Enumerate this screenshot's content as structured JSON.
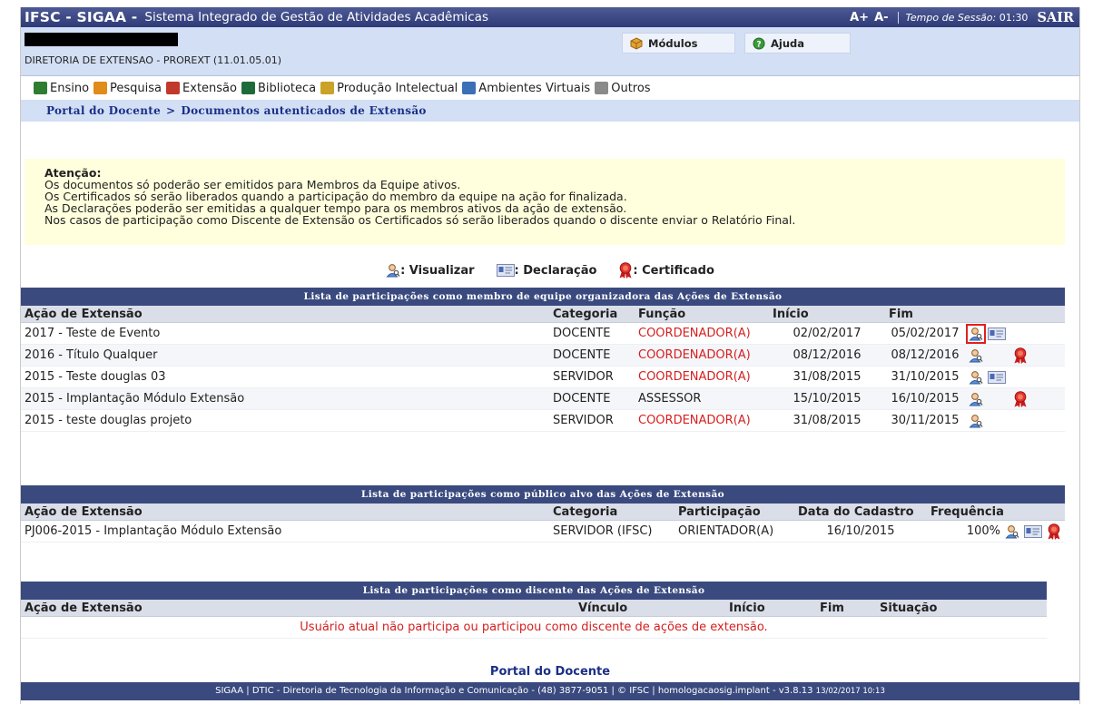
{
  "header": {
    "brand": "IFSC - SIGAA -",
    "system": "Sistema Integrado de Gestão de Atividades Acadêmicas",
    "font_up": "A+",
    "font_down": "A-",
    "session_label": "Tempo de Sessão:",
    "session_time": "01:30",
    "logout": "SAIR"
  },
  "info": {
    "department": "DIRETORIA DE EXTENSAO - PROREXT (11.01.05.01)",
    "modules_label": "Módulos",
    "help_label": "Ajuda"
  },
  "menu": [
    {
      "label": "Ensino",
      "icon": "books-icon",
      "color": "#2e7d32"
    },
    {
      "label": "Pesquisa",
      "icon": "flask-icon",
      "color": "#e08b1a"
    },
    {
      "label": "Extensão",
      "icon": "handshake-icon",
      "color": "#c0392b"
    },
    {
      "label": "Biblioteca",
      "icon": "library-icon",
      "color": "#1e6b3a"
    },
    {
      "label": "Produção Intelectual",
      "icon": "document-icon",
      "color": "#c9a227"
    },
    {
      "label": "Ambientes Virtuais",
      "icon": "people-icon",
      "color": "#3b6fb6"
    },
    {
      "label": "Outros",
      "icon": "gear-icon",
      "color": "#8a8a8a"
    }
  ],
  "breadcrumb": {
    "root": "Portal do Docente",
    "separator": ">",
    "current": "Documentos autenticados de Extensão"
  },
  "attention": {
    "title": "Atenção:",
    "lines": [
      "Os documentos só poderão ser emitidos para Membros da Equipe ativos.",
      "Os Certificados só serão liberados quando a participação do membro da equipe na ação for finalizada.",
      "As Declarações poderão ser emitidas a qualquer tempo para os membros ativos da ação de extensão.",
      "Nos casos de participação como Discente de Extensão os Certificados só serão liberados quando o discente enviar o Relatório Final."
    ]
  },
  "legend": {
    "view": ": Visualizar",
    "declaration": ": Declaração",
    "certificate": ": Certificado"
  },
  "table_team": {
    "caption": "Lista de participações como membro de equipe organizadora das Ações de Extensão",
    "headers": [
      "Ação de Extensão",
      "Categoria",
      "Função",
      "Início",
      "Fim"
    ],
    "rows": [
      {
        "action": "2017 - Teste de Evento",
        "category": "DOCENTE",
        "role": "COORDENADOR(A)",
        "start": "02/02/2017",
        "end": "05/02/2017"
      },
      {
        "action": "2016 - Título Qualquer",
        "category": "DOCENTE",
        "role": "COORDENADOR(A)",
        "start": "08/12/2016",
        "end": "08/12/2016"
      },
      {
        "action": "2015 - Teste douglas 03",
        "category": "SERVIDOR",
        "role": "COORDENADOR(A)",
        "start": "31/08/2015",
        "end": "31/10/2015"
      },
      {
        "action": "2015 - Implantação Módulo Extensão",
        "category": "DOCENTE",
        "role": "ASSESSOR",
        "start": "15/10/2015",
        "end": "16/10/2015"
      },
      {
        "action": "2015 - teste douglas projeto",
        "category": "SERVIDOR",
        "role": "COORDENADOR(A)",
        "start": "31/08/2015",
        "end": "30/11/2015"
      }
    ]
  },
  "table_public": {
    "caption": "Lista de participações como público alvo das Ações de Extensão",
    "headers": [
      "Ação de Extensão",
      "Categoria",
      "Participação",
      "Data do Cadastro",
      "Frequência"
    ],
    "rows": [
      {
        "action": "PJ006-2015 - Implantação Módulo Extensão",
        "category": "SERVIDOR (IFSC)",
        "participation": "ORIENTADOR(A)",
        "date": "16/10/2015",
        "frequency": "100%"
      }
    ]
  },
  "table_student": {
    "caption": "Lista de participações como discente das Ações de Extensão",
    "headers": [
      "Ação de Extensão",
      "Vínculo",
      "Início",
      "Fim",
      "Situação"
    ],
    "empty": "Usuário atual não participa ou participou como discente de ações de extensão."
  },
  "footer": {
    "portal_link": "Portal do Docente",
    "text": "SIGAA | DTIC - Diretoria de Tecnologia da Informação e Comunicação - (48) 3877-9051 | © IFSC | homologacaosig.implant - v3.8.13",
    "timestamp": "13/02/2017 10:13"
  },
  "colors": {
    "header_bg": "#2f3b77",
    "table_caption_bg": "#3a4a7f",
    "role_red": "#d61f1f",
    "attention_bg": "#ffffdd",
    "info_bg": "#d2dff4"
  }
}
